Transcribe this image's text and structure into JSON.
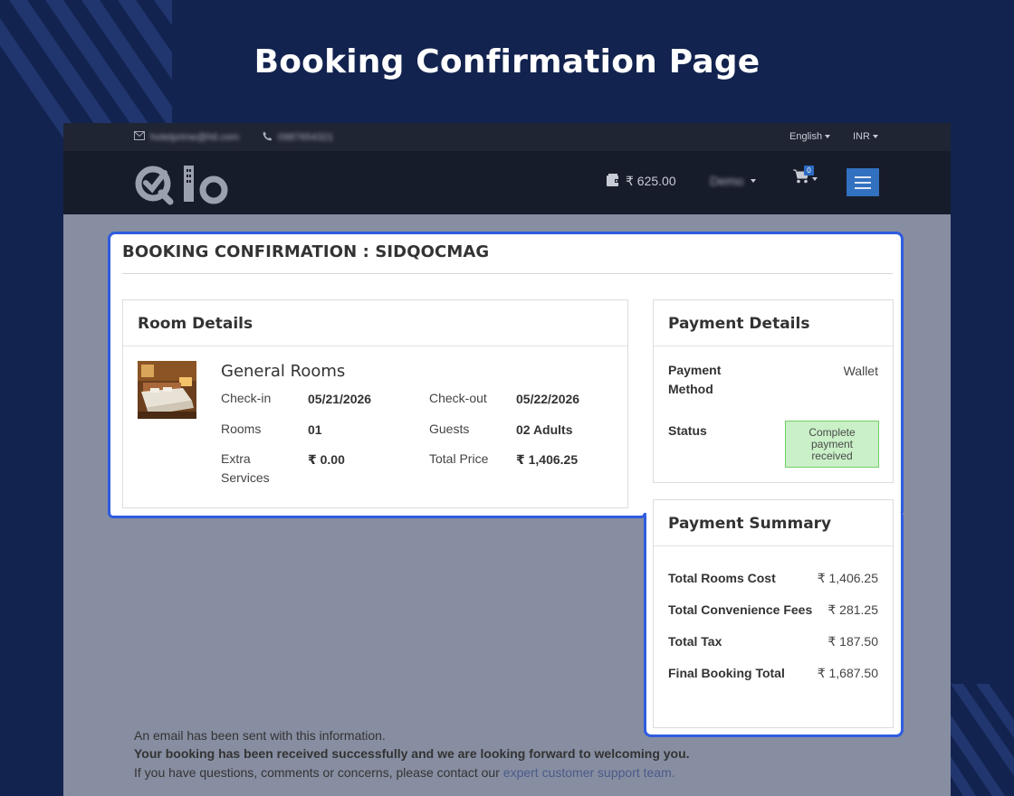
{
  "heading": "Booking Confirmation Page",
  "topbar": {
    "email": "hotelprime@htl.com",
    "phone": "0987654321",
    "language": "English",
    "currency": "INR"
  },
  "navbar": {
    "logo_text": "Qlo",
    "wallet_amount": "₹ 625.00",
    "user_name": "Demo",
    "cart_count": "0"
  },
  "booking": {
    "title": "BOOKING CONFIRMATION : SIDQOCMAG"
  },
  "room_details": {
    "title": "Room Details",
    "room_name": "General Rooms",
    "checkin_label": "Check-in",
    "checkin_value": "05/21/2026",
    "checkout_label": "Check-out",
    "checkout_value": "05/22/2026",
    "rooms_label": "Rooms",
    "rooms_value": "01",
    "guests_label": "Guests",
    "guests_value": "02 Adults",
    "extra_label_1": "Extra",
    "extra_label_2": "Services",
    "extra_value": "₹ 0.00",
    "total_label": "Total Price",
    "total_value": "₹ 1,406.25"
  },
  "payment_details": {
    "title": "Payment Details",
    "method_label_1": "Payment",
    "method_label_2": "Method",
    "method_value": "Wallet",
    "status_label": "Status",
    "status_line_1": "Complete",
    "status_line_2": "payment",
    "status_line_3": "received",
    "status_color": "#c9f0c7"
  },
  "payment_summary": {
    "title": "Payment Summary",
    "rows": [
      {
        "label": "Total Rooms Cost",
        "value": "₹ 1,406.25"
      },
      {
        "label": "Total Convenience Fees",
        "value": "₹ 281.25"
      },
      {
        "label": "Total Tax",
        "value": "₹ 187.50"
      },
      {
        "label": "Final Booking Total",
        "value": "₹ 1,687.50"
      }
    ]
  },
  "footer": {
    "line1": "An email has been sent with this information.",
    "line2": "Your booking has been received successfully and we are looking forward to welcoming you.",
    "line3_prefix": "If you have questions, comments or concerns, please contact our ",
    "line3_link": "expert customer support team."
  },
  "colors": {
    "page_bg": "#13234f",
    "highlight": "#2f5ce0",
    "menu_button": "#3270c0"
  }
}
